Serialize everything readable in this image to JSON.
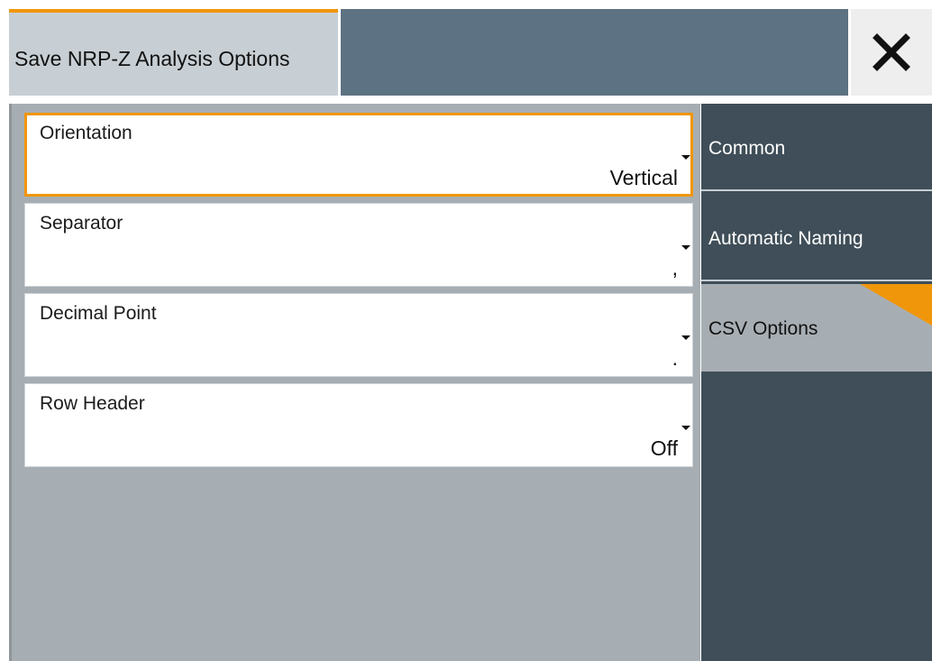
{
  "dialog": {
    "title": "Save NRP-Z Analysis Options",
    "close_icon": "close-icon"
  },
  "fields": [
    {
      "label": "Orientation",
      "value": "Vertical",
      "focused": true
    },
    {
      "label": "Separator",
      "value": ",",
      "focused": false
    },
    {
      "label": "Decimal Point",
      "value": ".",
      "focused": false
    },
    {
      "label": "Row Header",
      "value": "Off",
      "focused": false
    }
  ],
  "tabs": [
    {
      "label": "Common",
      "active": false
    },
    {
      "label": "Automatic Naming",
      "active": false
    },
    {
      "label": "CSV Options",
      "active": true
    }
  ],
  "colors": {
    "accent": "#f0960a",
    "header": "#5d7282",
    "panel": "#a7aeb3",
    "tab_dark": "#3f4e58"
  }
}
